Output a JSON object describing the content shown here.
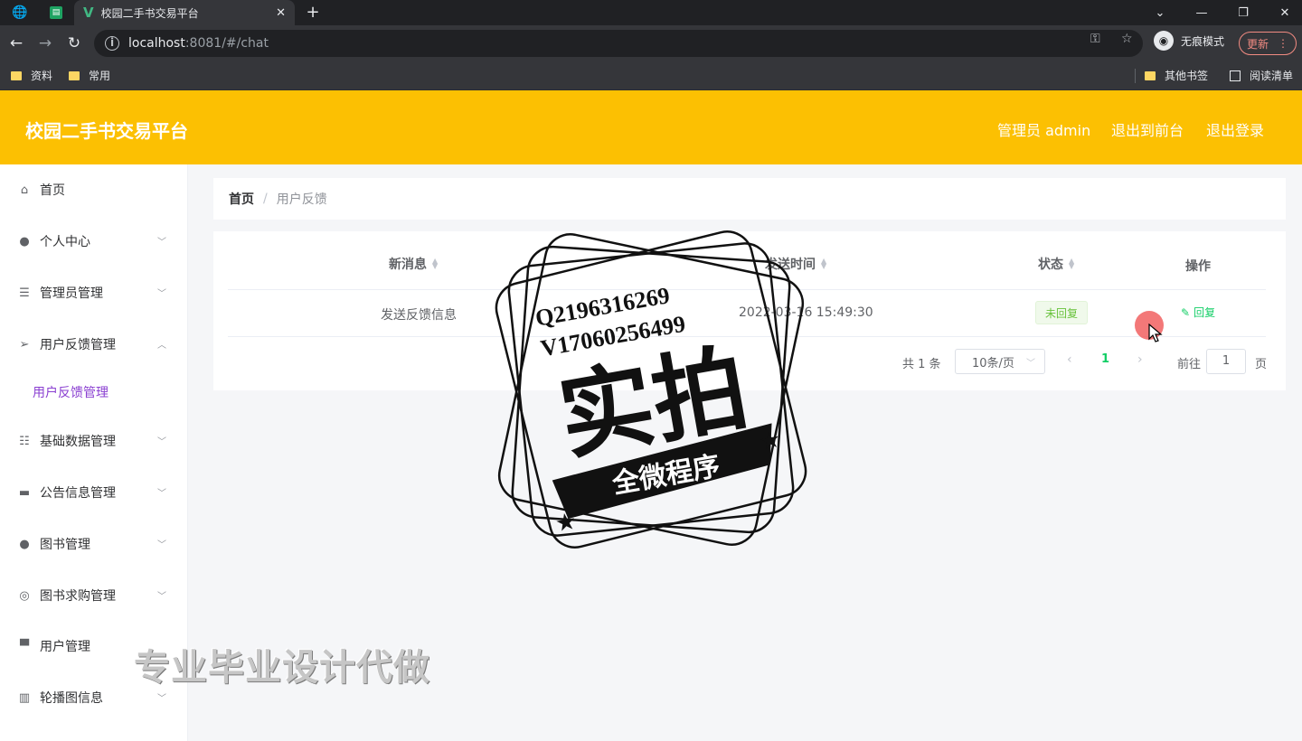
{
  "browser": {
    "tab_title": "校园二手书交易平台",
    "url_host": "localhost",
    "url_rest": ":8081/#/chat",
    "incognito_label": "无痕模式",
    "update_label": "更新",
    "bookmarks": [
      "资料",
      "常用"
    ],
    "bookmarks_right": [
      "其他书签",
      "阅读清单"
    ]
  },
  "header": {
    "title": "校园二手书交易平台",
    "admin_label": "管理员 admin",
    "to_front_label": "退出到前台",
    "logout_label": "退出登录"
  },
  "sidebar": {
    "items": [
      {
        "label": "首页",
        "icon": "home-icon"
      },
      {
        "label": "个人中心",
        "icon": "user-icon"
      },
      {
        "label": "管理员管理",
        "icon": "menu-icon"
      },
      {
        "label": "用户反馈管理",
        "icon": "send-icon"
      },
      {
        "label": "基础数据管理",
        "icon": "sliders-icon"
      },
      {
        "label": "公告信息管理",
        "icon": "monitor-icon"
      },
      {
        "label": "图书管理",
        "icon": "user-icon"
      },
      {
        "label": "图书求购管理",
        "icon": "lifebuoy-icon"
      },
      {
        "label": "用户管理",
        "icon": "stamp-icon"
      },
      {
        "label": "轮播图信息",
        "icon": "books-icon"
      }
    ],
    "sub_item": "用户反馈管理"
  },
  "breadcrumb": {
    "home": "首页",
    "current": "用户反馈"
  },
  "table": {
    "columns": [
      "新消息",
      "发送时间",
      "状态",
      "操作"
    ],
    "rows": [
      {
        "message": "发送反馈信息",
        "time": "2022-03-16 15:49:30",
        "status": "未回复",
        "action": "回复"
      }
    ]
  },
  "pagination": {
    "total": "共 1 条",
    "page_size": "10条/页",
    "current_page": "1",
    "goto_label": "前往",
    "goto_value": "1",
    "page_unit": "页"
  },
  "overlay": {
    "stamp_qq": "Q2196316269",
    "stamp_v": "V1706025649​9",
    "stamp_main": "实拍",
    "stamp_banner": "全微程序",
    "watermark": "专业毕业设计代做"
  }
}
